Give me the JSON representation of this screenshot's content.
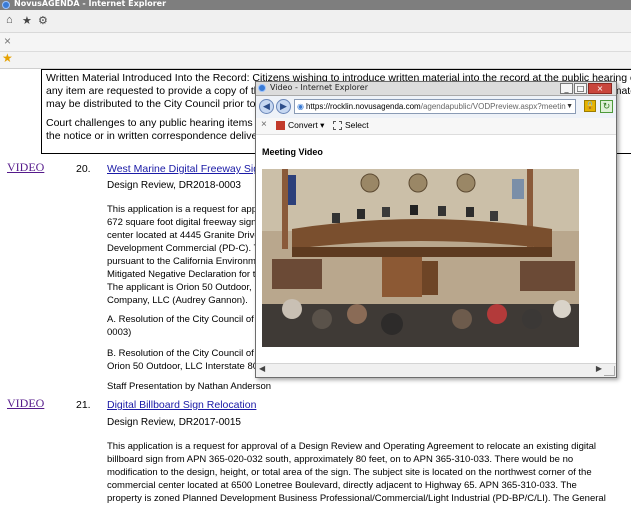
{
  "browser": {
    "title": "NovusAGENDA - Internet Explorer",
    "close_tab_glyph": "×"
  },
  "notice": {
    "line1": "Written Material Introduced Into the Record: Citizens wishing to introduce written material into the record at the public hearing on",
    "line2": "any item are requested to provide a copy of the written material to the City Clerk prior to the hearing. Copies of the written material",
    "line3": "may be distributed to the City Council prior to the",
    "line4": "Court challenges to any public hearing items may",
    "line5": "the notice or in written correspondence delivered"
  },
  "items": [
    {
      "video_label": "VIDEO",
      "number": "20.",
      "title": "West Marine Digital Freeway Sign",
      "review": "Design Review, DR2018-0003",
      "desc_lines": [
        "This application is a request for appro",
        "672 square foot digital freeway sign a",
        "center located at 4445 Granite Drive,",
        "Development Commercial (PD-C).  The",
        "pursuant to the California Environmen",
        "Mitigated Negative Declaration for th",
        "The applicant is Orion 50 Outdoor, LLC",
        "Company, LLC (Audrey Gannon)."
      ],
      "res_a": [
        "A.     Resolution of the City Council of",
        "0003)"
      ],
      "res_b": [
        "B.     Resolution of the City Council of",
        "Orion 50 Outdoor, LLC Interstate 80 a"
      ],
      "staff": "Staff Presentation by Nathan Anderson"
    },
    {
      "video_label": "VIDEO",
      "number": "21.",
      "title": "Digital Billboard Sign Relocation",
      "review": "Design Review, DR2017-0015",
      "desc_lines": [
        "This application is a request for approval of a Design Review and Operating Agreement to relocate an existing digital",
        "billboard sign from APN 365-020-032 south, approximately 80 feet, on to APN 365-310-033. There would be no",
        "modification to the design, height, or total area of the sign. The subject site is located on the northwest corner of the",
        "commercial center located at 6500 Lonetree Boulevard, directly adjacent to Highway 65.  APN 365-310-033. The",
        "property is zoned Planned Development Business Professional/Commercial/Light Industrial (PD-BP/C/LI). The General"
      ]
    }
  ],
  "popup": {
    "title": "Video - Internet Explorer",
    "url_domain": "https://rocklin.novusagenda.com",
    "url_rest": "/agendapublic/VODPreview.aspx?meetin",
    "convert_label": "Convert",
    "select_label": "Select",
    "heading": "Meeting Video",
    "window_buttons": {
      "minimize": "_",
      "maximize": "□",
      "close": "×"
    },
    "scroll_left": "◀",
    "scroll_right": "▶"
  }
}
